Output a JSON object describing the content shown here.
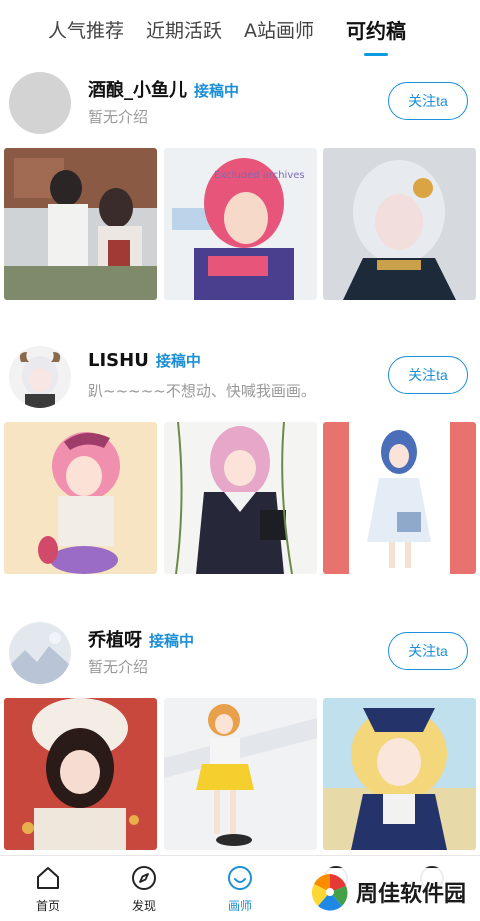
{
  "tabs": [
    {
      "label": "人气推荐"
    },
    {
      "label": "近期活跃"
    },
    {
      "label": "A站画师"
    },
    {
      "label": "可约稿"
    }
  ],
  "artists": [
    {
      "name": "酒酿_小鱼儿",
      "badge": "接稿中",
      "bio": "暂无介绍",
      "follow_label": "关注ta"
    },
    {
      "name": "LISHU",
      "badge": "接稿中",
      "bio": "趴~~~~~不想动、快喊我画画。",
      "follow_label": "关注ta"
    },
    {
      "name": "乔植呀",
      "badge": "接稿中",
      "bio": "暂无介绍",
      "follow_label": "关注ta"
    }
  ],
  "nav": [
    {
      "label": "首页",
      "icon": "home-icon"
    },
    {
      "label": "发现",
      "icon": "compass-icon"
    },
    {
      "label": "画师",
      "icon": "smile-icon"
    },
    {
      "label": "",
      "icon": "tab-icon"
    },
    {
      "label": "",
      "icon": "tab-icon"
    }
  ],
  "watermark": {
    "text": "周佳软件园"
  },
  "colors": {
    "accent": "#1c8fd6",
    "tab_underline": "#0b9be0",
    "muted_text": "#999999"
  }
}
